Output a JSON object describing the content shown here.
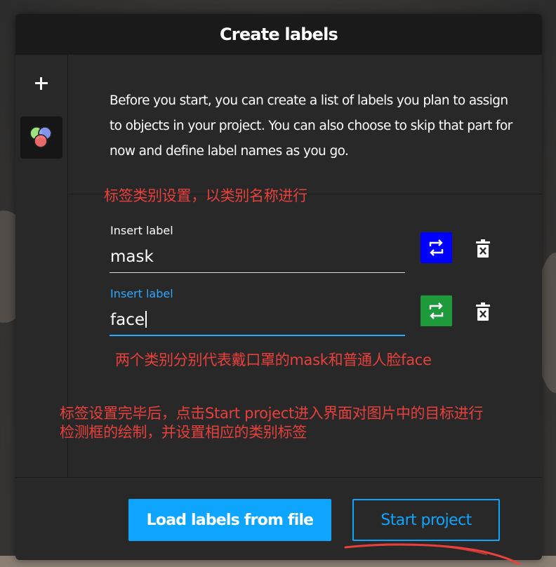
{
  "dialog": {
    "title": "Create labels",
    "description": "Before you start, you can create a list of labels you plan to assign to objects in your project. You can also choose to skip that part for now and define label names as you go."
  },
  "sidebar": {
    "add_icon": "plus-icon",
    "palette_icon": "color-circles-icon"
  },
  "labels": [
    {
      "field_label": "Insert label",
      "value": "mask",
      "color": "#0000ff",
      "active": false
    },
    {
      "field_label": "Insert label",
      "value": "face",
      "color": "#1e9a3a",
      "active": true
    }
  ],
  "annotations": {
    "note1": "标签类别设置，以类别名称进行",
    "note2": "两个类别分别代表戴口罩的mask和普通人脸face",
    "note3_line1": "标签设置完毕后，点击Start project进入界面对图片中的目标进行",
    "note3_line2": "检测框的绘制，并设置相应的类别标签",
    "color": "#e8403c"
  },
  "footer": {
    "load_label": "Load labels from file",
    "start_label": "Start project",
    "accent": "#0ea5ff"
  }
}
